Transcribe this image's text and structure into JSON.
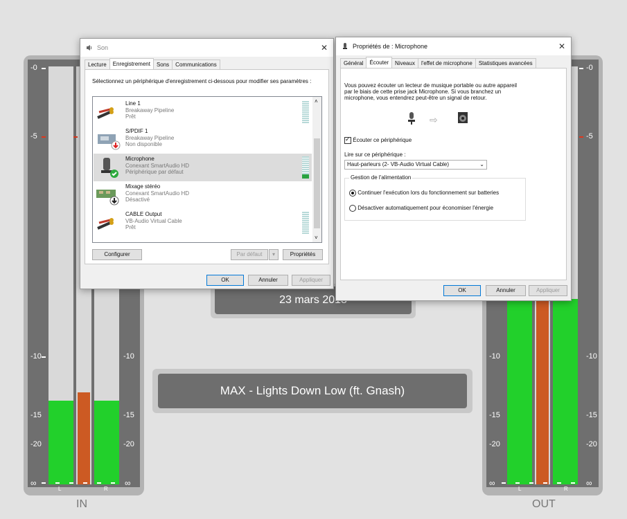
{
  "meters": {
    "left_caption": "IN",
    "right_caption": "OUT",
    "scale_labels": [
      "-0",
      "-5",
      "-10",
      "-15",
      "-20",
      "∞"
    ],
    "left_channel": "L",
    "right_channel": "R",
    "in_levels": {
      "left": 0.2,
      "peak": 0.25,
      "right": 0.2
    },
    "out_levels": {
      "left": 0.55,
      "peak": 0.55,
      "right": 0.55
    }
  },
  "date_display": "23 mars 2018",
  "now_playing": "MAX - Lights Down Low (ft. Gnash)",
  "son_dialog": {
    "title": "Son",
    "tabs": [
      "Lecture",
      "Enregistrement",
      "Sons",
      "Communications"
    ],
    "instruction": "Sélectionnez un périphérique d'enregistrement ci-dessous pour modifier ses paramètres :",
    "devices": [
      {
        "name": "Line 1",
        "driver": "Breakaway Pipeline",
        "status": "Prêt"
      },
      {
        "name": "S/PDIF 1",
        "driver": "Breakaway Pipeline",
        "status": "Non disponible"
      },
      {
        "name": "Microphone",
        "driver": "Conexant SmartAudio HD",
        "status": "Périphérique par défaut"
      },
      {
        "name": "Mixage stéréo",
        "driver": "Conexant SmartAudio HD",
        "status": "Désactivé"
      },
      {
        "name": "CABLE Output",
        "driver": "VB-Audio Virtual Cable",
        "status": "Prêt"
      }
    ],
    "configure_label": "Configurer",
    "default_label": "Par défaut",
    "properties_label": "Propriétés",
    "ok_label": "OK",
    "cancel_label": "Annuler",
    "apply_label": "Appliquer"
  },
  "mic_dialog": {
    "title": "Propriétés de : Microphone",
    "tabs": [
      "Général",
      "Écouter",
      "Niveaux",
      "l'effet de microphone",
      "Statistiques avancées"
    ],
    "description": "Vous pouvez écouter un lecteur de musique portable ou autre appareil par le biais de cette prise jack Microphone. Si vous branchez un microphone, vous entendrez peut-être un signal de retour.",
    "listen_checkbox": "Écouter ce périphérique",
    "playback_label": "Lire sur ce périphérique :",
    "playback_value": "Haut-parleurs (2- VB-Audio Virtual Cable)",
    "power_group": "Gestion de l'alimentation",
    "power_option_1": "Continuer l'exécution lors du fonctionnement sur batteries",
    "power_option_2": "Désactiver automatiquement pour économiser l'énergie",
    "ok_label": "OK",
    "cancel_label": "Annuler",
    "apply_label": "Appliquer"
  }
}
